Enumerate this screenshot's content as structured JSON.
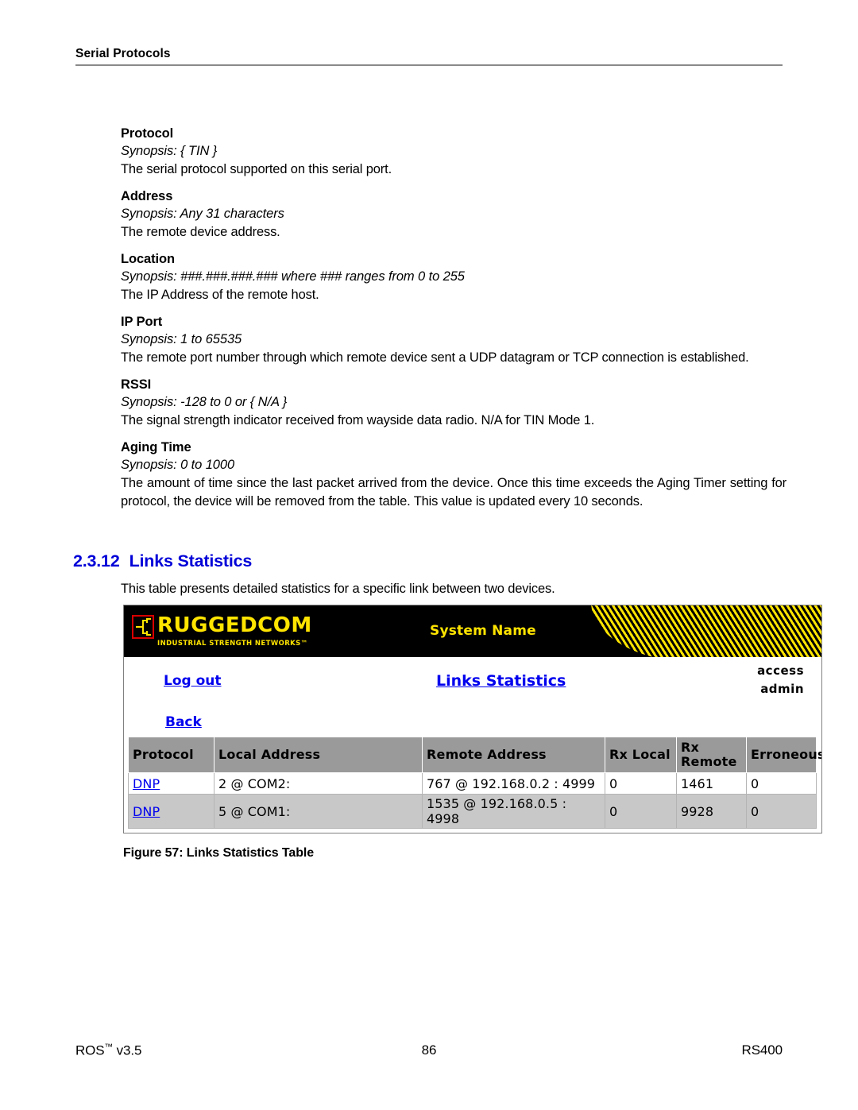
{
  "header": {
    "running_head": "Serial Protocols"
  },
  "fields": [
    {
      "name": "Protocol",
      "synopsis": "Synopsis: { TIN }",
      "description": "The serial protocol supported on this serial port."
    },
    {
      "name": "Address",
      "synopsis": "Synopsis: Any 31 characters",
      "description": "The remote device address."
    },
    {
      "name": "Location",
      "synopsis": "Synopsis: ###.###.###.###  where ### ranges from 0 to 255",
      "description": "The IP Address of the remote host."
    },
    {
      "name": "IP Port",
      "synopsis": "Synopsis: 1 to 65535",
      "description": "The remote port number through which remote device sent a UDP datagram or TCP connection is established."
    },
    {
      "name": "RSSI",
      "synopsis": "Synopsis: -128 to 0  or { N/A }",
      "description": "The signal strength indicator received from wayside data radio. N/A for TIN Mode 1."
    },
    {
      "name": "Aging Time",
      "synopsis": "Synopsis: 0 to 1000",
      "description": "The amount of time since the last packet arrived from the device. Once this time exceeds the Aging Timer setting for protocol, the device will be removed from the table. This value is updated every 10 seconds."
    }
  ],
  "section": {
    "number": "2.3.12",
    "title": "Links Statistics",
    "intro": "This table presents detailed statistics for a specific link between two devices.",
    "heading_color": "#0000d8"
  },
  "screenshot": {
    "banner": {
      "logo_main": "RUGGEDCOM",
      "logo_sub": "INDUSTRIAL STRENGTH NETWORKS™",
      "system_name": "System Name",
      "background_color": "#000000",
      "accent_color": "#ffe400"
    },
    "nav": {
      "logout_label": "Log out",
      "back_label": "Back",
      "page_title": "Links Statistics",
      "access_label": "access",
      "access_value": "admin",
      "link_color": "#0000ee"
    },
    "table": {
      "columns": [
        "Protocol",
        "Local Address",
        "Remote Address",
        "Rx Local",
        "Rx Remote",
        "Erroneous"
      ],
      "rows": [
        {
          "protocol": "DNP",
          "local_address": "2 @ COM2:",
          "remote_address": "767 @ 192.168.0.2 : 4999",
          "rx_local": "0",
          "rx_remote": "1461",
          "erroneous": "0"
        },
        {
          "protocol": "DNP",
          "local_address": "5 @ COM1:",
          "remote_address": "1535 @ 192.168.0.5 : 4998",
          "rx_local": "0",
          "rx_remote": "9928",
          "erroneous": "0"
        }
      ],
      "header_background": "#9a9a9a",
      "row_alt_background": "#c8c8c8"
    }
  },
  "figure": {
    "caption": "Figure 57: Links Statistics Table"
  },
  "footer": {
    "left_product": "ROS",
    "left_trademark": "™",
    "left_version": " v3.5",
    "page_number": "86",
    "right_model": "RS400"
  }
}
